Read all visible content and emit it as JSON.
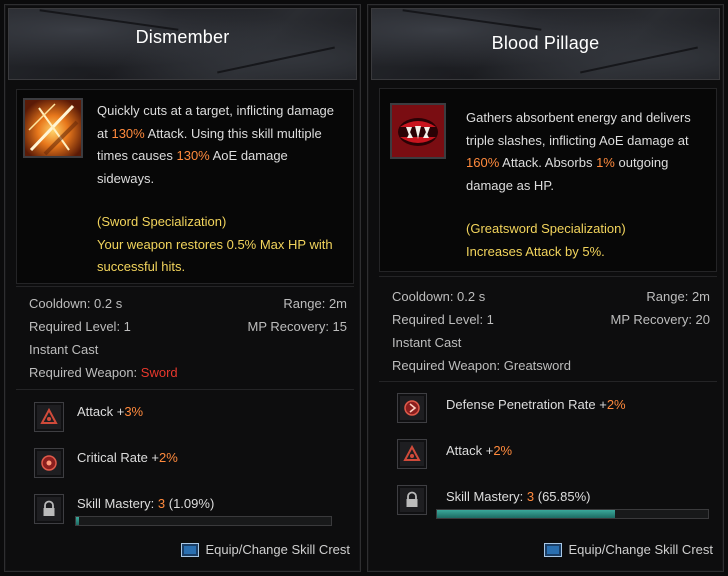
{
  "left": {
    "title": "Dismember",
    "icon": "crossed-slash-skill-icon",
    "desc": {
      "p1": "Quickly cuts at a target, inflicting damage at ",
      "v1": "130%",
      "p2": " Attack. Using this skill multiple times causes ",
      "v2": "130%",
      "p3": " AoE damage sideways."
    },
    "spec": {
      "title": "(Sword Specialization)",
      "text": "Your weapon restores 0.5% Max HP with successful hits."
    },
    "stats": {
      "cooldown": "Cooldown: 0.2 s",
      "range": "Range: 2m",
      "required_level": "Required Level: 1",
      "mp_recovery": "MP Recovery: 15",
      "cast": "Instant Cast",
      "weapon_label": "Required Weapon: ",
      "weapon_value": "Sword"
    },
    "effects": [
      {
        "label": "Attack +",
        "value": "3%",
        "icon": "attack-icon"
      },
      {
        "label": "Critical Rate +",
        "value": "2%",
        "icon": "critical-rate-icon"
      }
    ],
    "mastery": {
      "label": "Skill Mastery: ",
      "level": "3",
      "percent_text": " (1.09%)",
      "fill": 0.0109,
      "icon": "lock-icon"
    },
    "footer": "Equip/Change Skill Crest"
  },
  "right": {
    "title": "Blood Pillage",
    "icon": "fanged-mouth-skill-icon",
    "desc": {
      "p1": "Gathers absorbent energy and delivers triple slashes, inflicting AoE damage at ",
      "v1": "160%",
      "p2": " Attack. Absorbs ",
      "v2": "1%",
      "p3": " outgoing damage as HP."
    },
    "spec": {
      "title": "(Greatsword Specialization)",
      "text": "Increases Attack by 5%."
    },
    "stats": {
      "cooldown": "Cooldown: 0.2 s",
      "range": "Range: 2m",
      "required_level": "Required Level: 1",
      "mp_recovery": "MP Recovery: 20",
      "cast": "Instant Cast",
      "weapon_label": "Required Weapon: Greatsword"
    },
    "effects": [
      {
        "label": "Defense Penetration Rate +",
        "value": "2%",
        "icon": "defense-penetration-icon"
      },
      {
        "label": "Attack +",
        "value": "2%",
        "icon": "attack-icon"
      }
    ],
    "mastery": {
      "label": "Skill Mastery: ",
      "level": "3",
      "percent_text": " (65.85%)",
      "fill": 0.6585,
      "icon": "lock-icon"
    },
    "footer": "Equip/Change Skill Crest"
  },
  "colors": {
    "highlight": "#ff8a3d",
    "specialization": "#f2d45c",
    "weapon_required": "#e8382c",
    "mastery_fill": "#3aa89a"
  }
}
